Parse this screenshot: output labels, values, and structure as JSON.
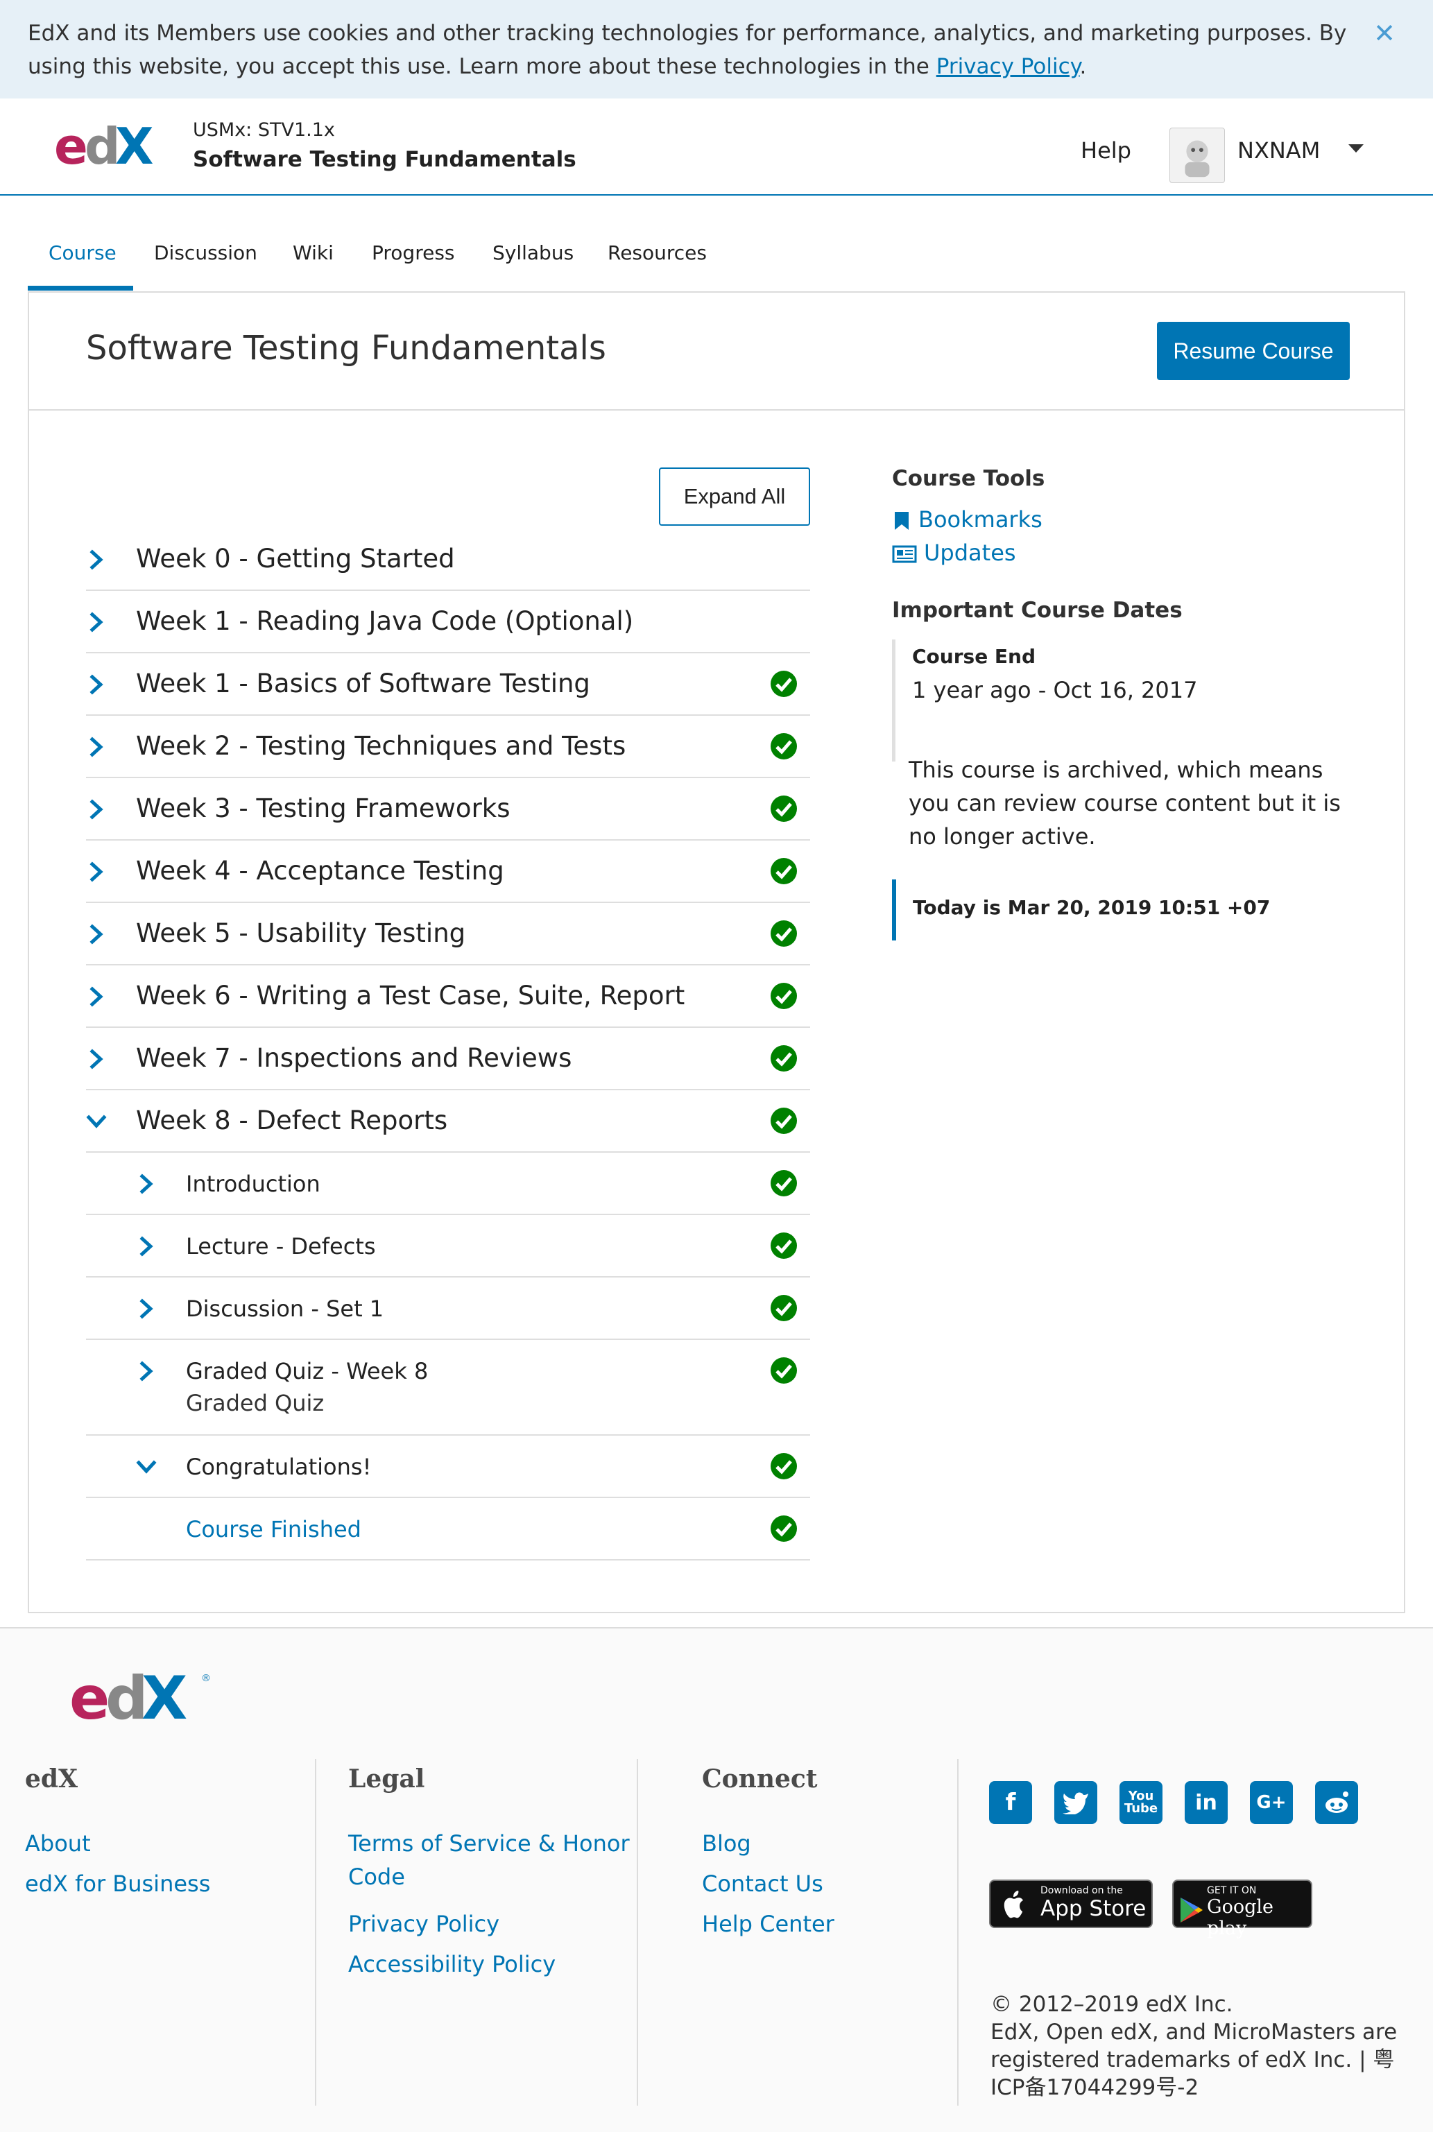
{
  "cookie": {
    "text": "EdX and its Members use cookies and other tracking technologies for performance, analytics, and marketing purposes. By using this website, you accept this use. Learn more about these technologies in the ",
    "link": "Privacy Policy",
    "end": "."
  },
  "header": {
    "course_code": "USMx: STV1.1x",
    "course_title": "Software Testing Fundamentals",
    "help": "Help",
    "username": "NXNAM"
  },
  "tabs": [
    "Course",
    "Discussion",
    "Wiki",
    "Progress",
    "Syllabus",
    "Resources"
  ],
  "main": {
    "title": "Software Testing Fundamentals",
    "resume": "Resume Course",
    "expand_all": "Expand All",
    "outline": [
      {
        "label": "Week 0 - Getting Started"
      },
      {
        "label": "Week 1 - Reading Java Code (Optional)"
      },
      {
        "label": "Week 1 - Basics of Software Testing"
      },
      {
        "label": "Week 2 - Testing Techniques and Tests"
      },
      {
        "label": "Week 3 - Testing Frameworks"
      },
      {
        "label": "Week 4 - Acceptance Testing"
      },
      {
        "label": "Week 5 - Usability Testing"
      },
      {
        "label": "Week 6 - Writing a Test Case, Suite, Report"
      },
      {
        "label": "Week 7 - Inspections and Reviews"
      },
      {
        "label": "Week 8 - Defect Reports"
      },
      {
        "label": "Introduction"
      },
      {
        "label": "Lecture - Defects"
      },
      {
        "label": "Discussion - Set 1"
      },
      {
        "label": "Graded Quiz - Week 8",
        "sub": "Graded Quiz"
      },
      {
        "label": "Congratulations!"
      },
      {
        "label": "Course Finished"
      }
    ]
  },
  "sidebar": {
    "tools_title": "Course Tools",
    "bookmarks": "Bookmarks",
    "updates": "Updates",
    "dates_title": "Important Course Dates",
    "course_end_label": "Course End",
    "course_end_value": "1 year ago - Oct 16, 2017",
    "archived_text": "This course is archived, which means you can review course content but it is no longer active.",
    "today": "Today is Mar 20, 2019 10:51 +07"
  },
  "footer": {
    "col1_title": "edX",
    "col1_links": [
      "About",
      "edX for Business"
    ],
    "col2_title": "Legal",
    "col2_links": [
      "Terms of Service & Honor Code",
      "Privacy Policy",
      "Accessibility Policy"
    ],
    "col3_title": "Connect",
    "col3_links": [
      "Blog",
      "Contact Us",
      "Help Center"
    ],
    "appstore_small": "Download on the",
    "appstore_big": "App Store",
    "googleplay_small": "GET IT ON",
    "googleplay_big": "Google play",
    "copyright_1": "© 2012–2019 edX Inc.",
    "copyright_2": "EdX, Open edX, and MicroMasters are registered trademarks of edX Inc. | 粤ICP备17044299号-2",
    "social_icons": [
      "facebook-icon",
      "twitter-icon",
      "youtube-icon",
      "linkedin-icon",
      "google-plus-icon",
      "reddit-icon"
    ]
  },
  "colors": {
    "accent": "#0075b4",
    "check": "#008100",
    "banner": "#e6f0f7"
  }
}
